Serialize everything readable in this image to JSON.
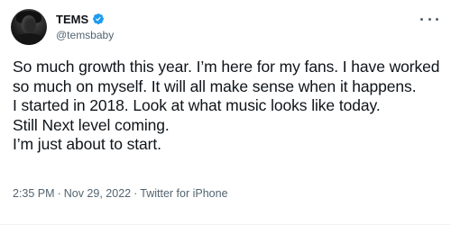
{
  "author": {
    "display_name": "TEMS",
    "handle": "@temsbaby",
    "verified_icon": "verified-badge-icon",
    "verified_color": "#1d9bf0"
  },
  "tweet": {
    "text": "So much growth this year. I’m here for my fans. I have worked so much on myself. It will all make sense when it happens.\nI started in 2018. Look at what music looks like today.\nStill Next level coming.\nI’m just about to start."
  },
  "meta": {
    "time": "2:35 PM",
    "date": "Nov 29, 2022",
    "source": "Twitter for iPhone",
    "separator": "·"
  },
  "more_menu_icon": "more-horizontal-icon"
}
